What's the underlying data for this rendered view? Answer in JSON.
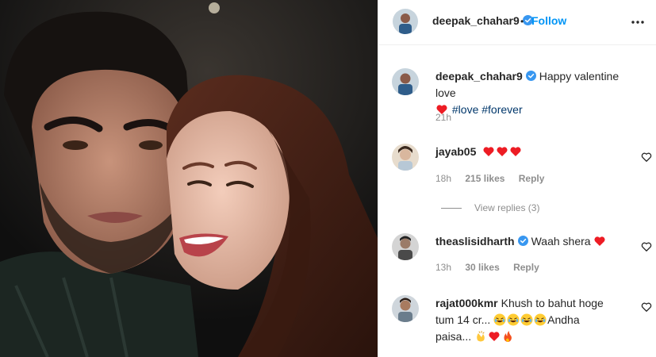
{
  "post": {
    "author": "deepak_chahar9",
    "follow_label": "Follow",
    "separator": "•",
    "caption": {
      "user": "deepak_chahar9",
      "text": "Happy valentine love",
      "tags": "#love #forever",
      "time": "21h"
    }
  },
  "comments": [
    {
      "user": "jayab05",
      "time": "18h",
      "likes": "215 likes",
      "reply": "Reply",
      "view_replies": "View replies (3)"
    },
    {
      "user": "theaslisidharth",
      "text": "Waah shera",
      "time": "13h",
      "likes": "30 likes",
      "reply": "Reply"
    },
    {
      "user": "rajat000kmr",
      "text_line1": "Khush to bahut hoge",
      "text_line2a": "tum 14 cr...",
      "text_line2b": "Andha",
      "text_line3": "paisa..."
    }
  ],
  "icons": {
    "verified": "verified-badge-icon",
    "more": "more-options-icon",
    "like": "heart-outline-icon"
  },
  "colors": {
    "accent": "#0095f6",
    "verified": "#3897f0",
    "heart": "#ed1c24",
    "muted": "#8e8e8e",
    "hashtag": "#00376b"
  }
}
